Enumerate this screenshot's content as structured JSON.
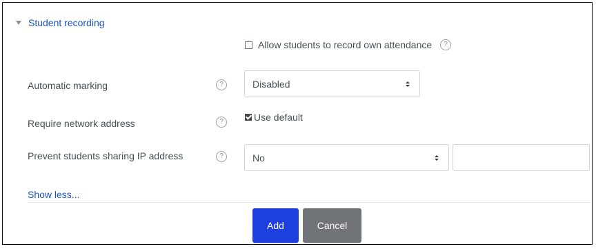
{
  "section": {
    "title": "Student recording"
  },
  "allow_record": {
    "label": "Allow students to record own attendance",
    "checked": false
  },
  "help_glyph": "?",
  "automatic_marking": {
    "label": "Automatic marking",
    "value": "Disabled"
  },
  "require_network": {
    "label": "Require network address",
    "checkbox_label": "Use default",
    "checked": true
  },
  "prevent_ip_sharing": {
    "label": "Prevent students sharing IP address",
    "value": "No",
    "extra_input_value": ""
  },
  "show_less_link": "Show less...",
  "buttons": {
    "add": "Add",
    "cancel": "Cancel"
  },
  "colors": {
    "primary": "#1d3fe0",
    "secondary": "#707478",
    "link": "#1a56c4"
  },
  "icons": {
    "collapse": "caret-down-icon",
    "help": "help-circle-icon",
    "select": "select-updown-icon"
  }
}
